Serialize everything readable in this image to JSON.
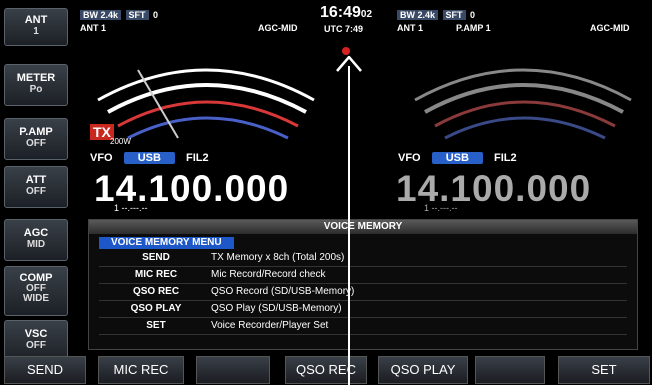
{
  "side_buttons": [
    {
      "title": "ANT",
      "value": "1"
    },
    {
      "title": "METER",
      "value": "Po"
    },
    {
      "title": "P.AMP",
      "value": "OFF"
    },
    {
      "title": "ATT",
      "value": "OFF"
    },
    {
      "title": "AGC",
      "value": "MID"
    },
    {
      "title": "COMP",
      "value": "OFF\nWIDE"
    },
    {
      "title": "VSC",
      "value": "OFF"
    }
  ],
  "left_status": {
    "bw": "BW 2.4k",
    "sft": "SFT",
    "sft_val": "0",
    "ant": "ANT 1",
    "agc": "AGC-MID"
  },
  "right_status": {
    "bw": "BW 2.4k",
    "sft": "SFT",
    "sft_val": "0",
    "ant": "ANT 1",
    "pamp": "P.AMP 1",
    "agc": "AGC-MID"
  },
  "clock": {
    "time": "16:49",
    "sec": "02",
    "utc": "UTC 7:49"
  },
  "tx_label": "TX",
  "power": "200W",
  "left_vfo": {
    "vfo": "VFO",
    "mode": "USB",
    "filter": "FIL2",
    "freq": "14.100.000",
    "sub": "1 --.---.--"
  },
  "right_vfo": {
    "vfo": "VFO",
    "mode": "USB",
    "filter": "FIL2",
    "freq": "14.100.000",
    "sub": "1 --.---.--"
  },
  "panel": {
    "title": "VOICE MEMORY",
    "menu_header": "VOICE MEMORY MENU",
    "rows": [
      {
        "key": "SEND",
        "desc": "TX Memory x 8ch (Total 200s)"
      },
      {
        "key": "MIC REC",
        "desc": "Mic Record/Record check"
      },
      {
        "key": "QSO REC",
        "desc": "QSO Record (SD/USB-Memory)"
      },
      {
        "key": "QSO PLAY",
        "desc": "QSO Play (SD/USB-Memory)"
      },
      {
        "key": "SET",
        "desc": "Voice Recorder/Player Set"
      }
    ]
  },
  "bottom_buttons": [
    "SEND",
    "MIC REC",
    "",
    "QSO REC",
    "QSO PLAY",
    "",
    "SET"
  ],
  "colors": {
    "accent": "#2860c8",
    "tx": "#c8281e",
    "menu": "#1e58c8"
  }
}
